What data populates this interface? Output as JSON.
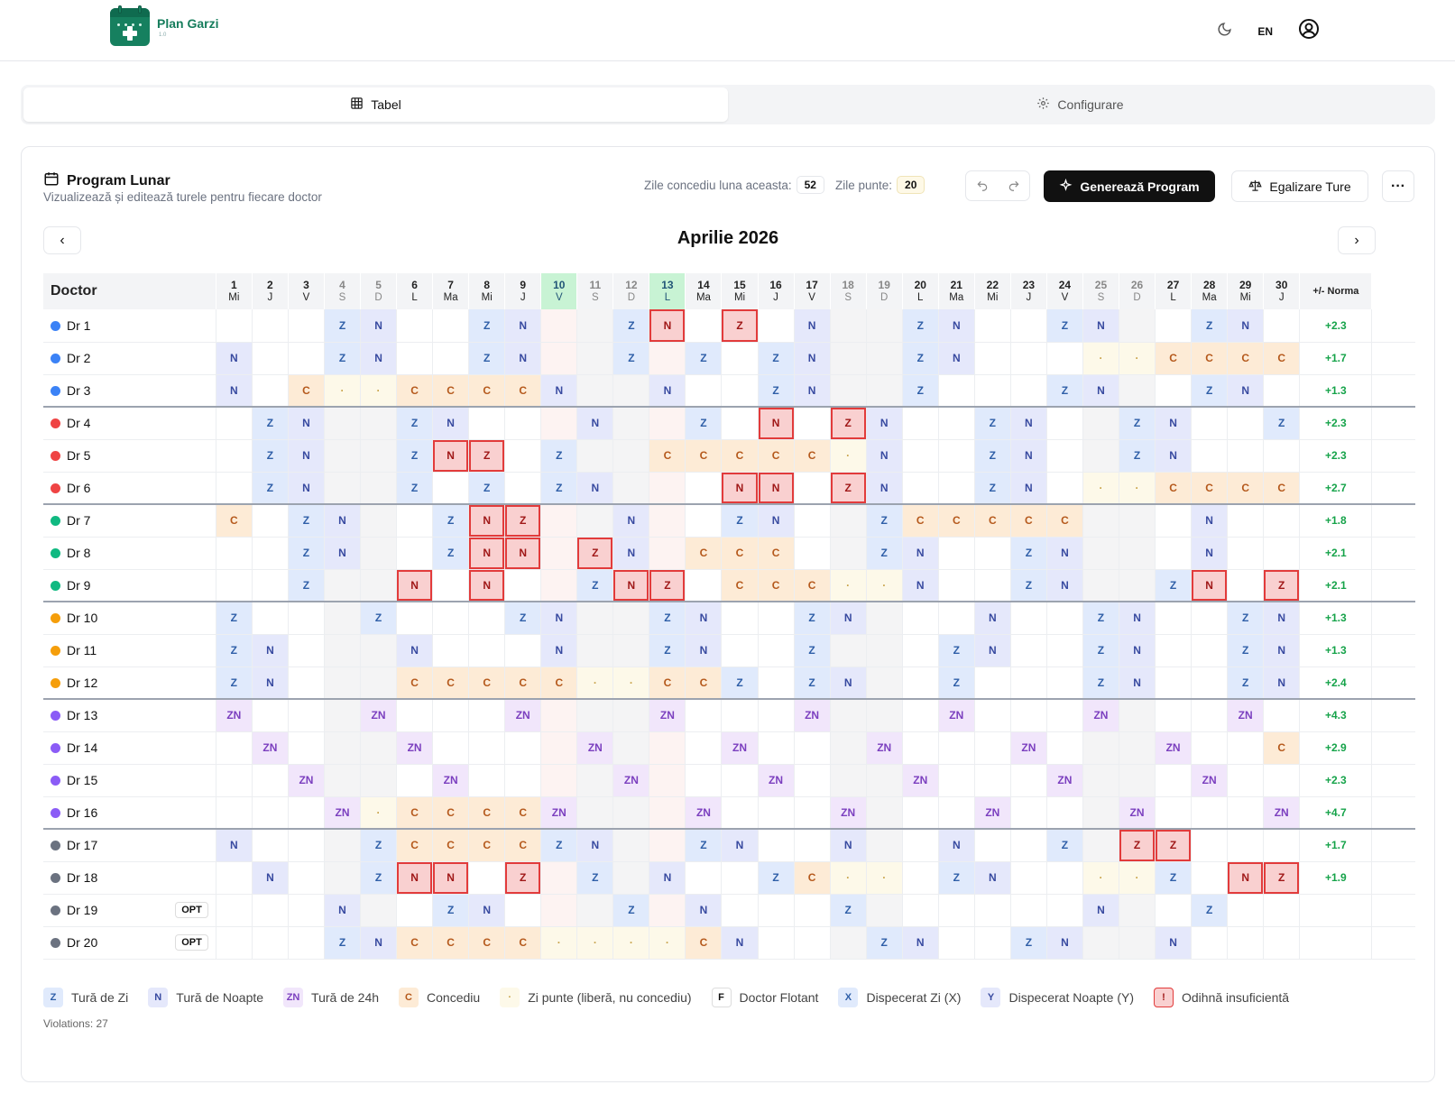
{
  "app": {
    "brand": "Plan Garzi",
    "brand_sub": "1.0",
    "lang": "EN"
  },
  "tabs": [
    {
      "label": "Tabel",
      "active": true
    },
    {
      "label": "Configurare",
      "active": false
    }
  ],
  "panel": {
    "title": "Program Lunar",
    "subtitle": "Vizualizează și editează turele pentru fiecare doctor",
    "vac_label": "Zile concediu luna aceasta:",
    "vac_value": "52",
    "bridge_label": "Zile punte:",
    "bridge_value": "20",
    "generate_label": "Generează Program",
    "equalize_label": "Egalizare Ture",
    "more_label": "···",
    "month": "Aprilie 2026"
  },
  "table": {
    "doctor_header": "Doctor",
    "norm_header": "+/- Norma",
    "days": [
      {
        "n": "1",
        "d": "Mi"
      },
      {
        "n": "2",
        "d": "J"
      },
      {
        "n": "3",
        "d": "V"
      },
      {
        "n": "4",
        "d": "S",
        "we": true
      },
      {
        "n": "5",
        "d": "D",
        "we": true
      },
      {
        "n": "6",
        "d": "L"
      },
      {
        "n": "7",
        "d": "Ma"
      },
      {
        "n": "8",
        "d": "Mi"
      },
      {
        "n": "9",
        "d": "J"
      },
      {
        "n": "10",
        "d": "V",
        "hol": true
      },
      {
        "n": "11",
        "d": "S",
        "we": true
      },
      {
        "n": "12",
        "d": "D",
        "we": true
      },
      {
        "n": "13",
        "d": "L",
        "hol": true
      },
      {
        "n": "14",
        "d": "Ma"
      },
      {
        "n": "15",
        "d": "Mi"
      },
      {
        "n": "16",
        "d": "J"
      },
      {
        "n": "17",
        "d": "V"
      },
      {
        "n": "18",
        "d": "S",
        "we": true
      },
      {
        "n": "19",
        "d": "D",
        "we": true
      },
      {
        "n": "20",
        "d": "L"
      },
      {
        "n": "21",
        "d": "Ma"
      },
      {
        "n": "22",
        "d": "Mi"
      },
      {
        "n": "23",
        "d": "J"
      },
      {
        "n": "24",
        "d": "V"
      },
      {
        "n": "25",
        "d": "S",
        "we": true
      },
      {
        "n": "26",
        "d": "D",
        "we": true
      },
      {
        "n": "27",
        "d": "L"
      },
      {
        "n": "28",
        "d": "Ma"
      },
      {
        "n": "29",
        "d": "Mi"
      },
      {
        "n": "30",
        "d": "J"
      }
    ],
    "doctors": [
      {
        "name": "Dr 1",
        "color": "#3b82f6",
        "norm": "+2.3",
        "shifts": {
          "4": "Z",
          "5": "N",
          "8": "Z",
          "9": "N",
          "12": "Z",
          "13": "N!",
          "15": "Z!",
          "17": "N",
          "20": "Z",
          "21": "N",
          "24": "Z",
          "25": "N",
          "28": "Z",
          "29": "N"
        }
      },
      {
        "name": "Dr 2",
        "color": "#3b82f6",
        "norm": "+1.7",
        "shifts": {
          "1": "N",
          "4": "Z",
          "5": "N",
          "8": "Z",
          "9": "N",
          "12": "Z",
          "14": "Z",
          "16": "Z",
          "17": "N",
          "20": "Z",
          "21": "N",
          "25": "·",
          "26": "·",
          "27": "C",
          "28": "C",
          "29": "C",
          "30": "C"
        }
      },
      {
        "name": "Dr 3",
        "color": "#3b82f6",
        "norm": "+1.3",
        "shifts": {
          "1": "N",
          "3": "C",
          "4": "·",
          "5": "·",
          "6": "C",
          "7": "C",
          "8": "C",
          "9": "C",
          "10": "N",
          "13": "N",
          "16": "Z",
          "17": "N",
          "20": "Z",
          "24": "Z",
          "25": "N",
          "28": "Z",
          "29": "N"
        }
      },
      {
        "name": "Dr 4",
        "color": "#ef4444",
        "norm": "+2.3",
        "shifts": {
          "2": "Z",
          "3": "N",
          "6": "Z",
          "7": "N",
          "11": "N",
          "14": "Z",
          "16": "N!",
          "18": "Z!",
          "19": "N",
          "22": "Z",
          "23": "N",
          "26": "Z",
          "27": "N",
          "30": "Z"
        }
      },
      {
        "name": "Dr 5",
        "color": "#ef4444",
        "norm": "+2.3",
        "shifts": {
          "2": "Z",
          "3": "N",
          "6": "Z",
          "7": "N!",
          "8": "Z!",
          "10": "Z",
          "13": "C",
          "14": "C",
          "15": "C",
          "16": "C",
          "17": "C",
          "18": "·",
          "19": "N",
          "22": "Z",
          "23": "N",
          "26": "Z",
          "27": "N"
        }
      },
      {
        "name": "Dr 6",
        "color": "#ef4444",
        "norm": "+2.7",
        "shifts": {
          "2": "Z",
          "3": "N",
          "6": "Z",
          "8": "Z",
          "10": "Z",
          "11": "N",
          "15": "N!",
          "16": "N!",
          "18": "Z!",
          "19": "N",
          "22": "Z",
          "23": "N",
          "25": "·",
          "26": "·",
          "27": "C",
          "28": "C",
          "29": "C",
          "30": "C"
        }
      },
      {
        "name": "Dr 7",
        "color": "#10b981",
        "norm": "+1.8",
        "shifts": {
          "1": "C",
          "3": "Z",
          "4": "N",
          "7": "Z",
          "8": "N!",
          "9": "Z!",
          "12": "N",
          "15": "Z",
          "16": "N",
          "19": "Z",
          "20": "C",
          "21": "C",
          "22": "C",
          "23": "C",
          "24": "C",
          "28": "N"
        }
      },
      {
        "name": "Dr 8",
        "color": "#10b981",
        "norm": "+2.1",
        "shifts": {
          "3": "Z",
          "4": "N",
          "7": "Z",
          "8": "N!",
          "9": "N!",
          "11": "Z!",
          "12": "N",
          "14": "C",
          "15": "C",
          "16": "C",
          "19": "Z",
          "20": "N",
          "23": "Z",
          "24": "N",
          "28": "N"
        }
      },
      {
        "name": "Dr 9",
        "color": "#10b981",
        "norm": "+2.1",
        "shifts": {
          "3": "Z",
          "6": "N!",
          "8": "N!",
          "11": "Z",
          "12": "N!",
          "13": "Z!",
          "15": "C",
          "16": "C",
          "17": "C",
          "18": "·",
          "19": "·",
          "20": "N",
          "23": "Z",
          "24": "N",
          "27": "Z",
          "28": "N!",
          "30": "Z!"
        }
      },
      {
        "name": "Dr 10",
        "color": "#f59e0b",
        "norm": "+1.3",
        "shifts": {
          "1": "Z",
          "5": "Z",
          "9": "Z",
          "10": "N",
          "13": "Z",
          "14": "N",
          "17": "Z",
          "18": "N",
          "22": "N",
          "25": "Z",
          "26": "N",
          "29": "Z",
          "30": "N"
        }
      },
      {
        "name": "Dr 11",
        "color": "#f59e0b",
        "norm": "+1.3",
        "shifts": {
          "1": "Z",
          "2": "N",
          "6": "N",
          "10": "N",
          "13": "Z",
          "14": "N",
          "17": "Z",
          "21": "Z",
          "22": "N",
          "25": "Z",
          "26": "N",
          "29": "Z",
          "30": "N"
        }
      },
      {
        "name": "Dr 12",
        "color": "#f59e0b",
        "norm": "+2.4",
        "shifts": {
          "1": "Z",
          "2": "N",
          "6": "C",
          "7": "C",
          "8": "C",
          "9": "C",
          "10": "C",
          "11": "·",
          "12": "·",
          "13": "C",
          "14": "C",
          "15": "Z",
          "17": "Z",
          "18": "N",
          "21": "Z",
          "25": "Z",
          "26": "N",
          "29": "Z",
          "30": "N"
        }
      },
      {
        "name": "Dr 13",
        "color": "#8b5cf6",
        "norm": "+4.3",
        "shifts": {
          "1": "ZN",
          "5": "ZN",
          "9": "ZN",
          "13": "ZN",
          "17": "ZN",
          "21": "ZN",
          "25": "ZN",
          "29": "ZN"
        }
      },
      {
        "name": "Dr 14",
        "color": "#8b5cf6",
        "norm": "+2.9",
        "shifts": {
          "2": "ZN",
          "6": "ZN",
          "11": "ZN",
          "15": "ZN",
          "19": "ZN",
          "23": "ZN",
          "27": "ZN",
          "30": "C"
        }
      },
      {
        "name": "Dr 15",
        "color": "#8b5cf6",
        "norm": "+2.3",
        "shifts": {
          "3": "ZN",
          "7": "ZN",
          "12": "ZN",
          "16": "ZN",
          "20": "ZN",
          "24": "ZN",
          "28": "ZN"
        }
      },
      {
        "name": "Dr 16",
        "color": "#8b5cf6",
        "norm": "+4.7",
        "shifts": {
          "4": "ZN",
          "5": "·",
          "6": "C",
          "7": "C",
          "8": "C",
          "9": "C",
          "10": "ZN",
          "14": "ZN",
          "18": "ZN",
          "22": "ZN",
          "26": "ZN",
          "30": "ZN"
        }
      },
      {
        "name": "Dr 17",
        "color": "#6b7280",
        "norm": "+1.7",
        "shifts": {
          "1": "N",
          "5": "Z",
          "6": "C",
          "7": "C",
          "8": "C",
          "9": "C",
          "10": "Z",
          "11": "N",
          "14": "Z",
          "15": "N",
          "18": "N",
          "21": "N",
          "24": "Z",
          "26": "Z!",
          "27": "Z!"
        }
      },
      {
        "name": "Dr 18",
        "color": "#6b7280",
        "norm": "+1.9",
        "shifts": {
          "2": "N",
          "5": "Z",
          "6": "N!",
          "7": "N!",
          "9": "Z!",
          "11": "Z",
          "13": "N",
          "16": "Z",
          "17": "C",
          "18": "·",
          "19": "·",
          "21": "Z",
          "22": "N",
          "25": "·",
          "26": "·",
          "27": "Z",
          "29": "N!",
          "30": "Z!"
        }
      },
      {
        "name": "Dr 19",
        "color": "#6b7280",
        "norm": "",
        "opt": "OPT",
        "shifts": {
          "4": "N",
          "7": "Z",
          "8": "N",
          "12": "Z",
          "14": "N",
          "18": "Z",
          "25": "N",
          "28": "Z"
        }
      },
      {
        "name": "Dr 20",
        "color": "#6b7280",
        "norm": "",
        "opt": "OPT",
        "shifts": {
          "4": "Z",
          "5": "N",
          "6": "C",
          "7": "C",
          "8": "C",
          "9": "C",
          "10": "·",
          "11": "·",
          "12": "·",
          "13": "·",
          "14": "C",
          "15": "N",
          "19": "Z",
          "20": "N",
          "23": "Z",
          "24": "N",
          "27": "N"
        }
      }
    ],
    "group_starts": [
      3,
      6,
      9,
      12,
      16
    ]
  },
  "legend": [
    {
      "code": "Z",
      "label": "Tură de Zi",
      "bg": "#e0eafc",
      "fg": "#2f5fa8"
    },
    {
      "code": "N",
      "label": "Tură de Noapte",
      "bg": "#e5e8fb",
      "fg": "#384aa0"
    },
    {
      "code": "ZN",
      "label": "Tură de 24h",
      "bg": "#f1e6fb",
      "fg": "#7b3fbf"
    },
    {
      "code": "C",
      "label": "Concediu",
      "bg": "#fdebd6",
      "fg": "#b5591c"
    },
    {
      "code": "·",
      "label": "Zi punte (liberă, nu concediu)",
      "bg": "#fdf9e9",
      "fg": "#c8a34a"
    },
    {
      "code": "F",
      "label": "Doctor Flotant",
      "bg": "#ffffff",
      "fg": "#111111",
      "border": "#dddddd"
    },
    {
      "code": "X",
      "label": "Dispecerat Zi (X)",
      "bg": "#e0eafc",
      "fg": "#2f5fa8"
    },
    {
      "code": "Y",
      "label": "Dispecerat Noapte (Y)",
      "bg": "#e5e8fb",
      "fg": "#384aa0"
    },
    {
      "code": "!",
      "label": "Odihnă insuficientă",
      "bg": "#f9d0d0",
      "fg": "#a01818",
      "border": "#e23b3b"
    }
  ],
  "violations": "Violations: 27"
}
